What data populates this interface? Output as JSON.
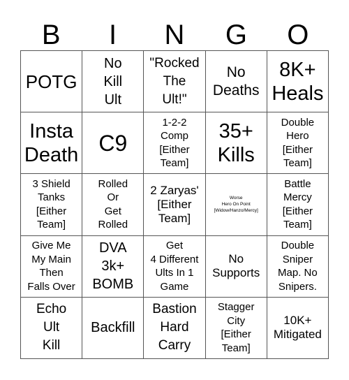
{
  "header": {
    "letters": [
      "B",
      "I",
      "N",
      "G",
      "O"
    ]
  },
  "cells": [
    "POTG",
    "No\nKill\nUlt",
    "\"Rocked\nThe\nUlt!\"",
    "No\nDeaths",
    "8K+\nHeals",
    "Insta\nDeath",
    "C9",
    "1-2-2\nComp\n[Either\nTeam]",
    "35+\nKills",
    "Double\nHero\n[Either\nTeam]",
    "3 Shield\nTanks\n[Either\nTeam]",
    "Rolled\nOr\nGet\nRolled",
    "2 Zaryas'\n[Either\nTeam]",
    "Worse\nHero On Point\n[Widow/Hanzo/Mercy]",
    "Battle\nMercy\n[Either\nTeam]",
    "Give Me\nMy Main\nThen\nFalls Over",
    "DVA\n3k+\nBOMB",
    "Get\n4 Different\nUlts In 1\nGame",
    "No\nSupports",
    "Double\nSniper\nMap. No\nSnipers.",
    "Echo\nUlt\nKill",
    "Backfill",
    "Bastion\nHard\nCarry",
    "Stagger\nCity\n[Either\nTeam]",
    "10K+\nMitigated"
  ]
}
